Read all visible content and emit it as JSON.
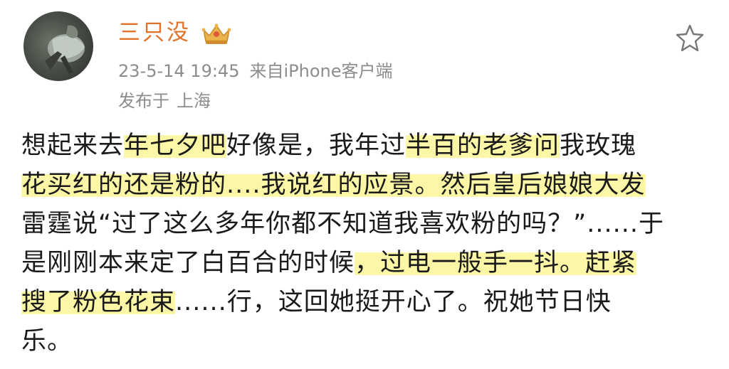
{
  "post": {
    "username": "三只没",
    "badge_icon": "crown-badge-icon",
    "date": "23-5-14 19:45",
    "source": "来自iPhone客户端",
    "location_label": "发布于",
    "location": "上海",
    "favorite_icon": "star-icon"
  },
  "content": {
    "lines": [
      [
        {
          "text": "想起来去",
          "hl": false
        },
        {
          "text": "年七夕吧",
          "hl": true
        },
        {
          "text": "好像是，我年过",
          "hl": false
        },
        {
          "text": "半百的老爹问",
          "hl": true
        },
        {
          "text": "我玫瑰",
          "hl": false
        }
      ],
      [
        {
          "text": "花买红的还是粉的....我说红的应景。",
          "hl": true
        },
        {
          "text": "然后皇后娘娘大发",
          "hl": true
        }
      ],
      [
        {
          "text": "雷霆说“过了这么多年你都不知道我喜欢粉的吗？”......于",
          "hl": false
        }
      ],
      [
        {
          "text": "是刚刚本来定了白百合的时候",
          "hl": false
        },
        {
          "text": "，过电一般手一抖。",
          "hl": true
        },
        {
          "text": "赶紧",
          "hl": true
        }
      ],
      [
        {
          "text": "搜了粉色花束",
          "hl": true
        },
        {
          "text": "......行，这回她挺开心了。祝她节日快",
          "hl": false
        }
      ],
      [
        {
          "text": "乐。",
          "hl": false
        }
      ]
    ]
  },
  "colors": {
    "username": "#e0722a",
    "meta": "#8c8c8c",
    "highlight": "#fbf7a6",
    "text": "#1a1a1a"
  }
}
